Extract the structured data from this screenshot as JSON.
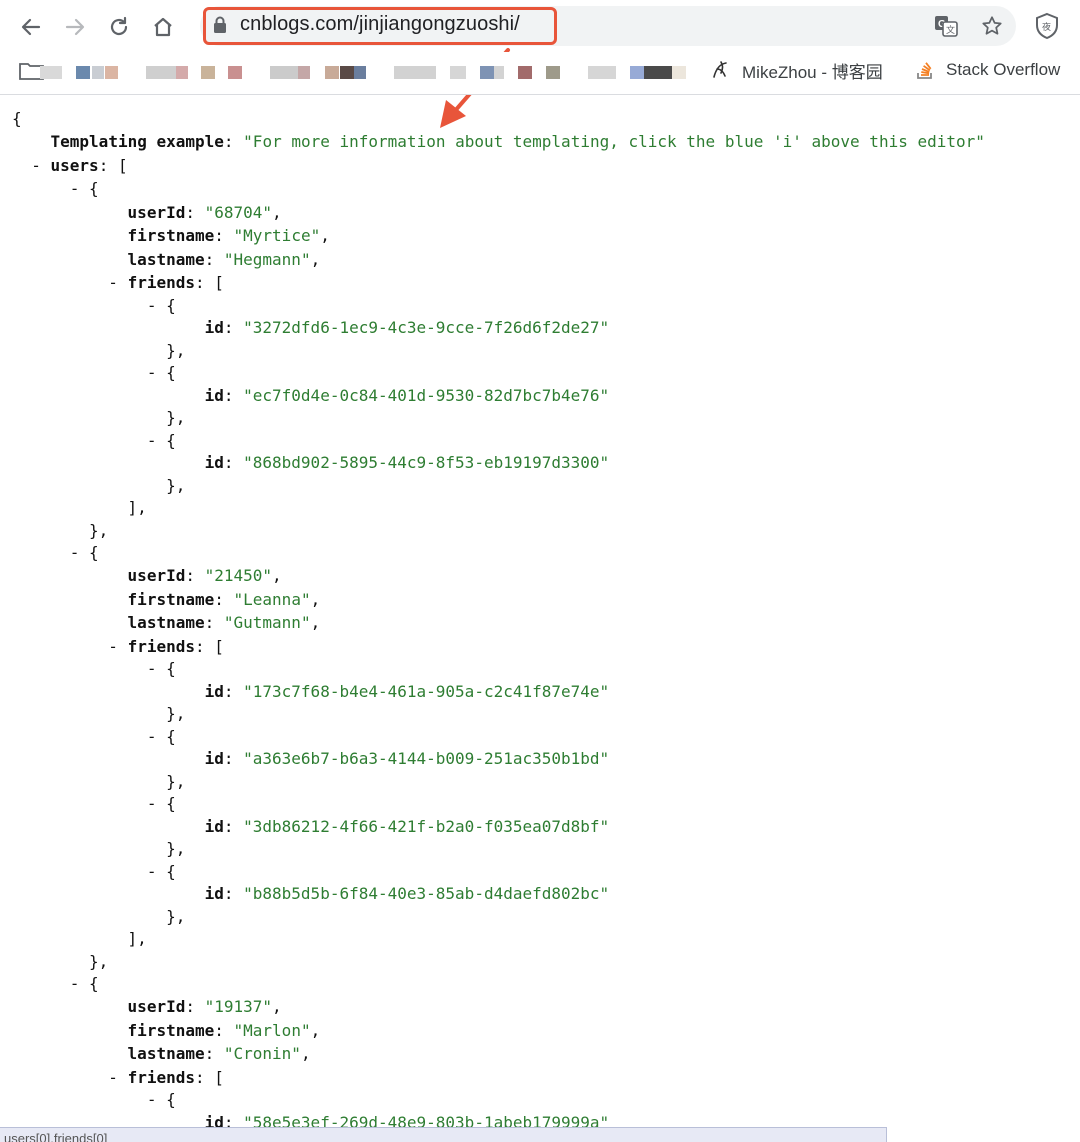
{
  "browser": {
    "url": "cnblogs.com/jinjiangongzuoshi/",
    "bookmarks": [
      {
        "label": "MikeZhou - 博客园"
      },
      {
        "label": "Stack Overflow"
      }
    ],
    "accent": "#e8553a"
  },
  "json_view": {
    "open_brace": "{",
    "templating": {
      "key": "Templating example",
      "value": "\"For more information about templating, click the blue 'i' above this editor\""
    },
    "users_key": "users",
    "users": [
      {
        "userId": "\"68704\"",
        "firstname": "\"Myrtice\"",
        "lastname": "\"Hegmann\"",
        "friends": [
          "\"3272dfd6-1ec9-4c3e-9cce-7f26d6f2de27\"",
          "\"ec7f0d4e-0c84-401d-9530-82d7bc7b4e76\"",
          "\"868bd902-5895-44c9-8f53-eb19197d3300\""
        ]
      },
      {
        "userId": "\"21450\"",
        "firstname": "\"Leanna\"",
        "lastname": "\"Gutmann\"",
        "friends": [
          "\"173c7f68-b4e4-461a-905a-c2c41f87e74e\"",
          "\"a363e6b7-b6a3-4144-b009-251ac350b1bd\"",
          "\"3db86212-4f66-421f-b2a0-f035ea07d8bf\"",
          "\"b88b5d5b-6f84-40e3-85ab-d4daefd802bc\""
        ]
      },
      {
        "userId": "\"19137\"",
        "firstname": "\"Marlon\"",
        "lastname": "\"Cronin\"",
        "friends": [
          "\"58e5e3ef-269d-48e9-803b-1abeb179999a\""
        ]
      }
    ],
    "labels": {
      "userId": "userId",
      "firstname": "firstname",
      "lastname": "lastname",
      "friends": "friends",
      "id": "id"
    }
  },
  "status": {
    "path": "users[0].friends[0]"
  }
}
